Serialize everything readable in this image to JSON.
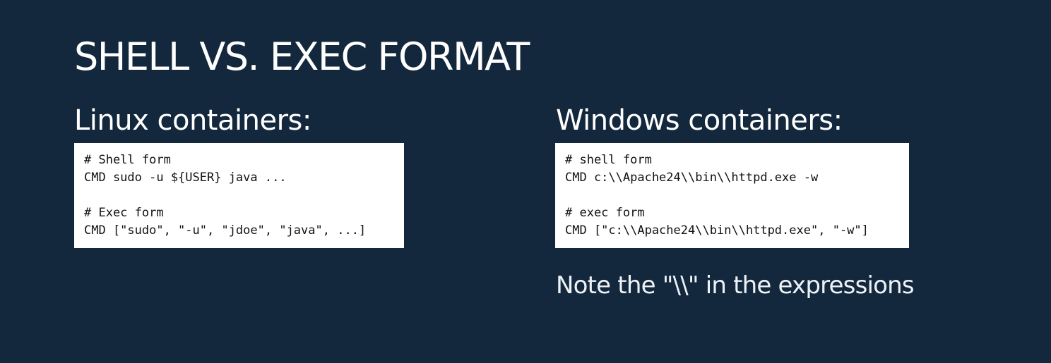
{
  "slide": {
    "title": "SHELL VS. EXEC FORMAT"
  },
  "linux": {
    "heading": "Linux containers:",
    "code": [
      "# Shell form",
      "CMD sudo -u ${USER} java ...",
      "",
      "# Exec form",
      "CMD [\"sudo\", \"-u\", \"jdoe\", \"java\", ...]"
    ]
  },
  "windows": {
    "heading": "Windows containers:",
    "code": [
      "# shell form",
      "CMD c:\\\\Apache24\\\\bin\\\\httpd.exe -w",
      "",
      "# exec form",
      "CMD [\"c:\\\\Apache24\\\\bin\\\\httpd.exe\", \"-w\"]"
    ],
    "note": "Note the \"\\\\\" in the expressions"
  },
  "colors": {
    "background": "#13283d",
    "text": "#ffffff",
    "code_background": "#ffffff",
    "code_text": "#111111"
  }
}
